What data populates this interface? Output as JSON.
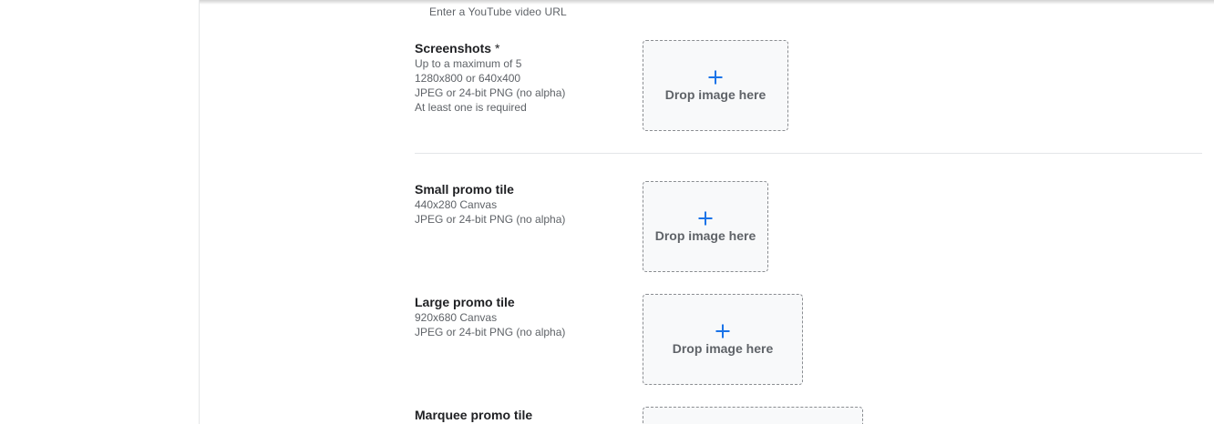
{
  "video": {
    "hint": "Enter a YouTube video URL"
  },
  "screenshots": {
    "label": "Screenshots",
    "required_mark": "*",
    "lines": [
      "Up to a maximum of 5",
      "1280x800 or 640x400",
      "JPEG or 24-bit PNG (no alpha)",
      "At least one is required"
    ],
    "drop_label": "Drop image here"
  },
  "small_promo": {
    "label": "Small promo tile",
    "lines": [
      "440x280 Canvas",
      "JPEG or 24-bit PNG (no alpha)"
    ],
    "drop_label": "Drop image here"
  },
  "large_promo": {
    "label": "Large promo tile",
    "lines": [
      "920x680 Canvas",
      "JPEG or 24-bit PNG (no alpha)"
    ],
    "drop_label": "Drop image here"
  },
  "marquee_promo": {
    "label": "Marquee promo tile"
  },
  "icons": {
    "add": "plus-icon"
  },
  "colors": {
    "accent": "#1a73e8",
    "dropzone_bg": "#f8f9fa",
    "dropzone_border": "#8a8d91"
  }
}
